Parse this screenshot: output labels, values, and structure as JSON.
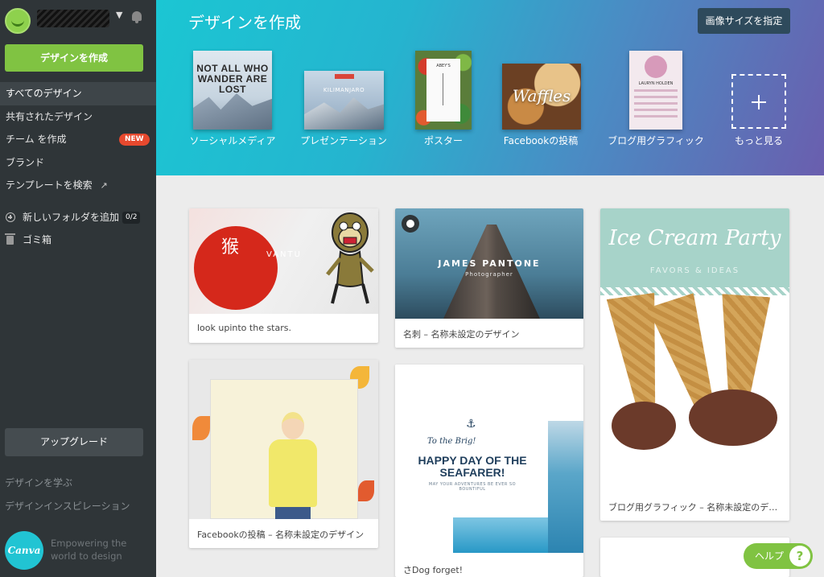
{
  "sidebar": {
    "create_label": "デザインを作成",
    "nav": [
      {
        "label": "すべてのデザイン"
      },
      {
        "label": "共有されたデザイン"
      },
      {
        "label": "チーム を作成",
        "badge": "NEW"
      },
      {
        "label": "ブランド"
      },
      {
        "label": "テンプレートを検索",
        "icon": "external-link-icon"
      }
    ],
    "nav2": [
      {
        "label": "新しいフォルダを追加",
        "badge": "0/2",
        "icon": "plus-circle-icon"
      },
      {
        "label": "ゴミ箱",
        "icon": "trash-icon"
      }
    ],
    "upgrade_label": "アップグレード",
    "learn": "デザインを学ぶ",
    "inspiration": "デザインインスピレーション",
    "logo_text": "Canva",
    "tagline": "Empowering the world to design"
  },
  "header": {
    "title": "デザインを作成",
    "size_button": "画像サイズを指定",
    "templates": [
      {
        "label": "ソーシャルメディア",
        "thumb_text": "NOT ALL WHO WANDER ARE LOST"
      },
      {
        "label": "プレゼンテーション",
        "thumb_text": "KILIMANJARO"
      },
      {
        "label": "ポスター",
        "thumb_text": "ABEY'S"
      },
      {
        "label": "Facebookの投稿",
        "thumb_text": "Waffles"
      },
      {
        "label": "ブログ用グラフィック",
        "thumb_text": "LAURYN HOLDEN"
      },
      {
        "label": "もっと見る"
      }
    ]
  },
  "designs": [
    {
      "caption": "look upinto the stars.",
      "thumb_text": "VANTU"
    },
    {
      "caption": "名刺 – 名称未設定のデザイン",
      "thumb_title": "JAMES PANTONE",
      "thumb_sub": "Photographer"
    },
    {
      "caption": "ブログ用グラフィック – 名称未設定のデザ...",
      "thumb_title": "Ice Cream Party",
      "thumb_sub": "FAVORS & IDEAS"
    },
    {
      "caption": "Facebookの投稿 – 名称未設定のデザイン"
    },
    {
      "caption": "さDog forget!",
      "thumb_small": "To the Brig!",
      "thumb_title": "HAPPY DAY OF THE SEAFARER!",
      "thumb_sub": "MAY YOUR ADVENTURES BE EVER SO BOUNTIFUL"
    }
  ],
  "help": {
    "label": "ヘルプ",
    "icon_text": "?"
  },
  "colors": {
    "accent": "#80c342",
    "sidebar": "#2f3538",
    "badge": "#e7492e"
  }
}
